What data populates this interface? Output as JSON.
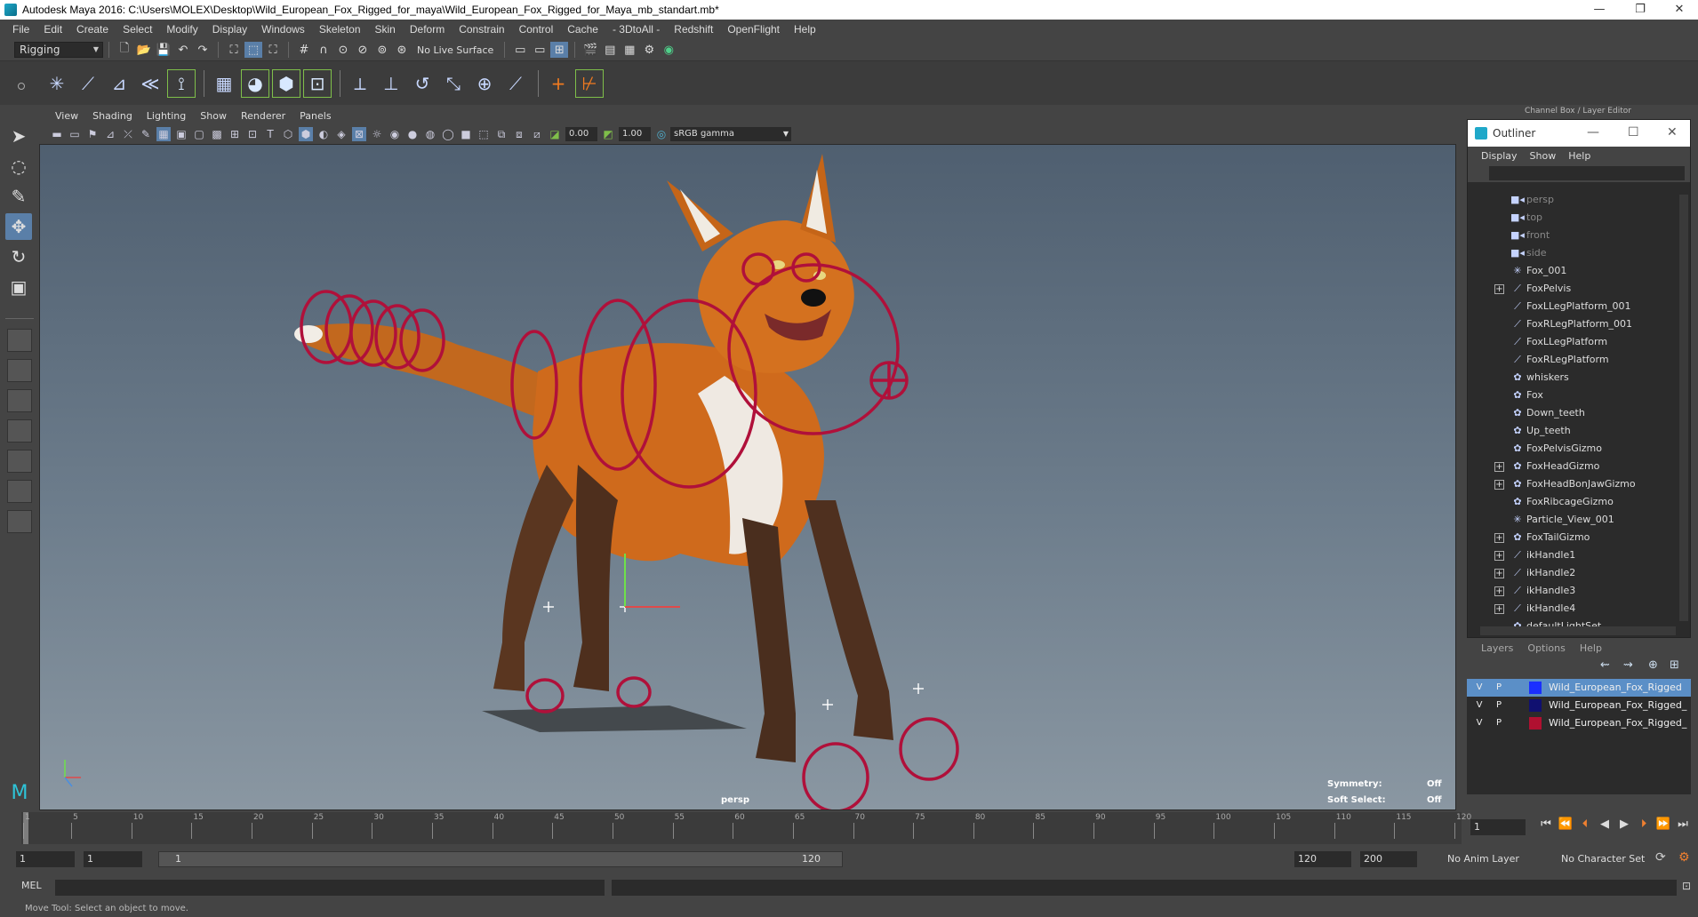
{
  "window": {
    "title": "Autodesk Maya 2016: C:\\Users\\MOLEX\\Desktop\\Wild_European_Fox_Rigged_for_maya\\Wild_European_Fox_Rigged_for_Maya_mb_standart.mb*",
    "minimize": "—",
    "restore": "❐",
    "close": "✕"
  },
  "menus": [
    "File",
    "Edit",
    "Create",
    "Select",
    "Modify",
    "Display",
    "Windows",
    "Skeleton",
    "Skin",
    "Deform",
    "Constrain",
    "Control",
    "Cache",
    "- 3DtoAll -",
    "Redshift",
    "OpenFlight",
    "Help"
  ],
  "status": {
    "mode": "Rigging",
    "live_surface": "No Live Surface"
  },
  "panel": {
    "menus": [
      "View",
      "Shading",
      "Lighting",
      "Show",
      "Renderer",
      "Panels"
    ],
    "field_a": "0.00",
    "field_b": "1.00",
    "color_space": "sRGB gamma"
  },
  "viewport": {
    "camera": "persp",
    "symmetry_label": "Symmetry:",
    "symmetry_value": "Off",
    "soft_select_label": "Soft Select:",
    "soft_select_value": "Off",
    "colors": {
      "rig": "#b0103a",
      "fur": "#d0681c",
      "belly": "#eeeae4",
      "leg": "#4a2e1e"
    }
  },
  "right_panel": {
    "header": "Channel Box / Layer Editor",
    "outliner_title": "Outliner",
    "outliner_menus": [
      "Display",
      "Show",
      "Help"
    ],
    "items": [
      {
        "label": "persp",
        "icon": "camera",
        "expand": false,
        "dim": true
      },
      {
        "label": "top",
        "icon": "camera",
        "expand": false,
        "dim": true
      },
      {
        "label": "front",
        "icon": "camera",
        "expand": false,
        "dim": true
      },
      {
        "label": "side",
        "icon": "camera",
        "expand": false,
        "dim": true
      },
      {
        "label": "Fox_001",
        "icon": "star",
        "expand": false,
        "dim": false
      },
      {
        "label": "FoxPelvis",
        "icon": "joint",
        "expand": true,
        "dim": false
      },
      {
        "label": "FoxLLegPlatform_001",
        "icon": "joint",
        "expand": false,
        "dim": false
      },
      {
        "label": "FoxRLegPlatform_001",
        "icon": "joint",
        "expand": false,
        "dim": false
      },
      {
        "label": "FoxLLegPlatform",
        "icon": "joint",
        "expand": false,
        "dim": false
      },
      {
        "label": "FoxRLegPlatform",
        "icon": "joint",
        "expand": false,
        "dim": false
      },
      {
        "label": "whiskers",
        "icon": "mesh",
        "expand": false,
        "dim": false
      },
      {
        "label": "Fox",
        "icon": "mesh",
        "expand": false,
        "dim": false
      },
      {
        "label": "Down_teeth",
        "icon": "mesh",
        "expand": false,
        "dim": false
      },
      {
        "label": "Up_teeth",
        "icon": "mesh",
        "expand": false,
        "dim": false
      },
      {
        "label": "FoxPelvisGizmo",
        "icon": "mesh",
        "expand": false,
        "dim": false
      },
      {
        "label": "FoxHeadGizmo",
        "icon": "mesh",
        "expand": true,
        "dim": false
      },
      {
        "label": "FoxHeadBonJawGizmo",
        "icon": "mesh",
        "expand": true,
        "dim": false
      },
      {
        "label": "FoxRibcageGizmo",
        "icon": "mesh",
        "expand": false,
        "dim": false
      },
      {
        "label": "Particle_View_001",
        "icon": "star",
        "expand": false,
        "dim": false
      },
      {
        "label": "FoxTailGizmo",
        "icon": "mesh",
        "expand": true,
        "dim": false
      },
      {
        "label": "ikHandle1",
        "icon": "joint",
        "expand": true,
        "dim": false
      },
      {
        "label": "ikHandle2",
        "icon": "joint",
        "expand": true,
        "dim": false
      },
      {
        "label": "ikHandle3",
        "icon": "joint",
        "expand": true,
        "dim": false
      },
      {
        "label": "ikHandle4",
        "icon": "joint",
        "expand": true,
        "dim": false
      },
      {
        "label": "defaultLightSet",
        "icon": "mesh",
        "expand": false,
        "dim": false
      }
    ],
    "layers_menus": [
      "Layers",
      "Options",
      "Help"
    ],
    "layers": [
      {
        "v": "V",
        "p": "P",
        "color": "#1a2fff",
        "name": "Wild_European_Fox_Rigged",
        "selected": true
      },
      {
        "v": "V",
        "p": "P",
        "color": "#101070",
        "name": "Wild_European_Fox_Rigged_",
        "selected": false
      },
      {
        "v": "V",
        "p": "P",
        "color": "#b01030",
        "name": "Wild_European_Fox_Rigged_",
        "selected": false
      }
    ]
  },
  "timeline": {
    "ticks": [
      1,
      5,
      10,
      15,
      20,
      25,
      30,
      35,
      40,
      45,
      50,
      55,
      60,
      65,
      70,
      75,
      80,
      85,
      90,
      95,
      100,
      105,
      110,
      115,
      120
    ],
    "current_frame": "1",
    "range_start": "1",
    "playback_start": "1",
    "range_inner_start": "1",
    "range_inner_end": "120",
    "playback_end": "120",
    "range_end": "200",
    "anim_layer": "No Anim Layer",
    "character_set": "No Character Set"
  },
  "command": {
    "language": "MEL",
    "help_text": "Move Tool: Select an object to move."
  }
}
